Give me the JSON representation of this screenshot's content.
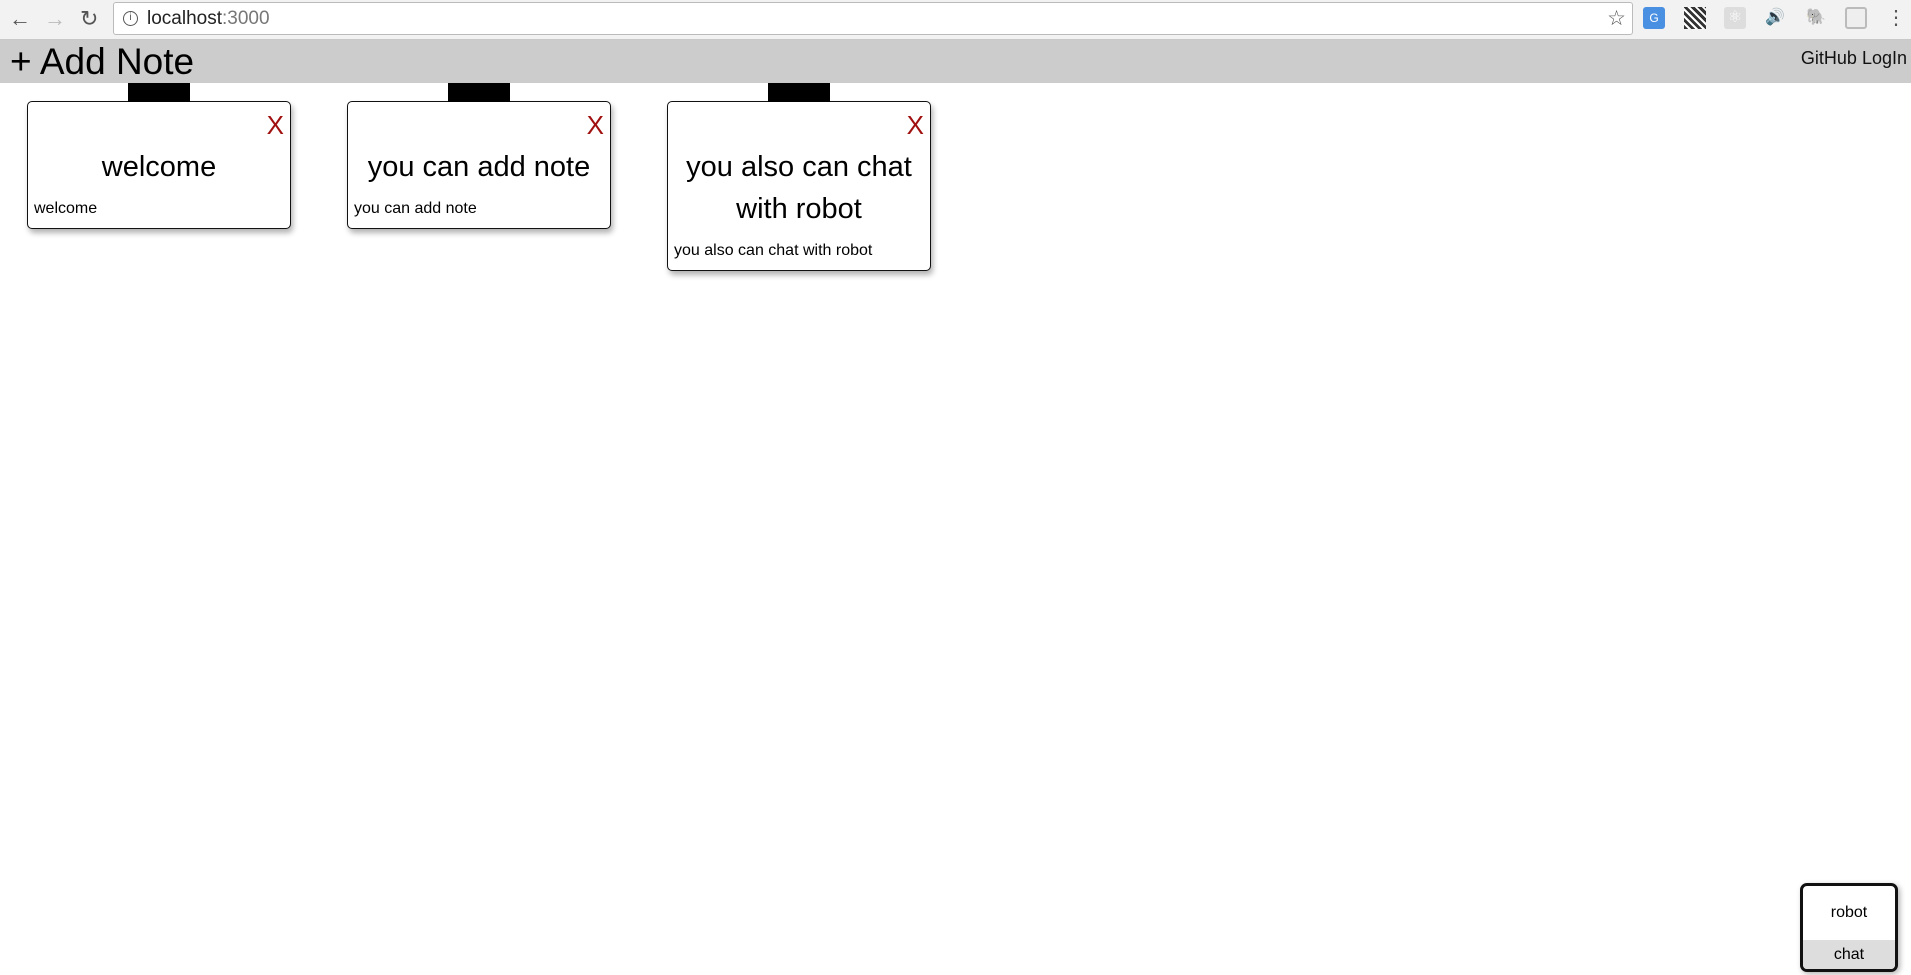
{
  "browser": {
    "url_host": "localhost",
    "url_port": ":3000"
  },
  "header": {
    "add_label": "+ Add Note",
    "login_label": "GitHub LogIn"
  },
  "notes": [
    {
      "title": "welcome",
      "body": "welcome",
      "close": "X"
    },
    {
      "title": "you can add note",
      "body": "you can add note",
      "close": "X"
    },
    {
      "title": "you also can chat with robot",
      "body": "you also can chat with robot",
      "close": "X"
    }
  ],
  "robot": {
    "label": "robot",
    "chat_label": "chat"
  }
}
